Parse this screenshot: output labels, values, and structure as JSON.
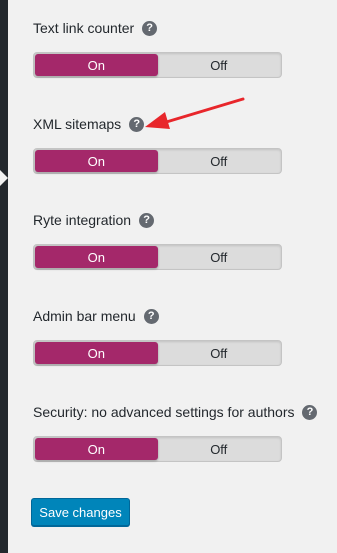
{
  "settings": [
    {
      "label": "Text link counter",
      "help_icon": "question-mark-icon",
      "help_glyph": "?",
      "on_label": "On",
      "off_label": "Off",
      "selected": "On"
    },
    {
      "label": "XML sitemaps",
      "help_icon": "question-mark-icon",
      "help_glyph": "?",
      "on_label": "On",
      "off_label": "Off",
      "selected": "On"
    },
    {
      "label": "Ryte integration",
      "help_icon": "question-mark-icon",
      "help_glyph": "?",
      "on_label": "On",
      "off_label": "Off",
      "selected": "On"
    },
    {
      "label": "Admin bar menu",
      "help_icon": "question-mark-icon",
      "help_glyph": "?",
      "on_label": "On",
      "off_label": "Off",
      "selected": "On"
    },
    {
      "label": "Security: no advanced settings for authors",
      "help_icon": "question-mark-icon",
      "help_glyph": "?",
      "on_label": "On",
      "off_label": "Off",
      "selected": "On"
    }
  ],
  "save_button": {
    "label": "Save changes"
  },
  "colors": {
    "toggle_on": "#a4286a",
    "button": "#0085ba",
    "annotation_arrow": "#e8262b"
  }
}
